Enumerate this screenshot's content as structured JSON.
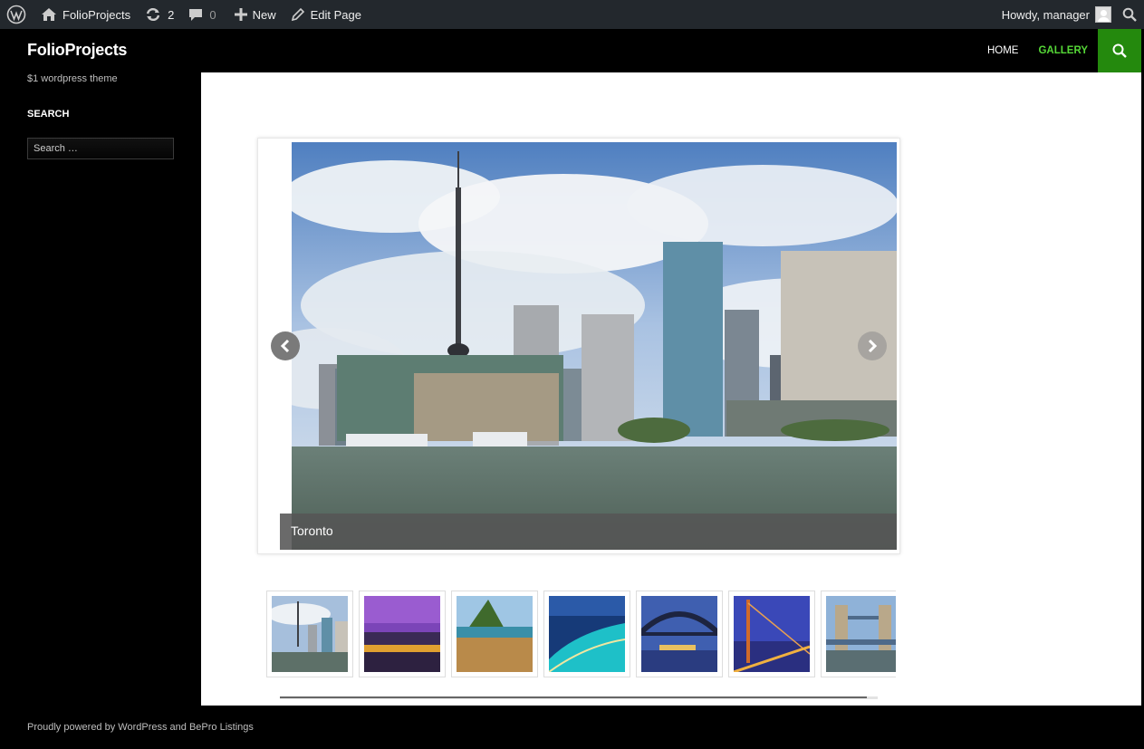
{
  "admin_bar": {
    "site_name": "FolioProjects",
    "updates_count": "2",
    "comments_count": "0",
    "new_label": "New",
    "edit_label": "Edit Page",
    "greeting": "Howdy, manager"
  },
  "header": {
    "site_title": "FolioProjects",
    "nav": [
      {
        "label": "HOME",
        "active": false
      },
      {
        "label": "GALLERY",
        "active": true
      }
    ]
  },
  "sidebar": {
    "tagline": "$1 wordpress theme",
    "widget_title": "SEARCH",
    "search_placeholder": "Search …"
  },
  "gallery": {
    "caption": "Toronto",
    "thumbnails": [
      {
        "subject": "toronto-skyline"
      },
      {
        "subject": "purple-bridge-night"
      },
      {
        "subject": "beach-mountain"
      },
      {
        "subject": "rio-beach-night"
      },
      {
        "subject": "sydney-harbour-bridge"
      },
      {
        "subject": "golden-gate-night"
      },
      {
        "subject": "tower-bridge"
      }
    ]
  },
  "footer": {
    "text": "Proudly powered by WordPress and BePro Listings"
  },
  "colors": {
    "admin_bar_bg": "#23282d",
    "accent_green": "#24890d",
    "active_nav": "#55d737",
    "page_bg": "#000000"
  }
}
